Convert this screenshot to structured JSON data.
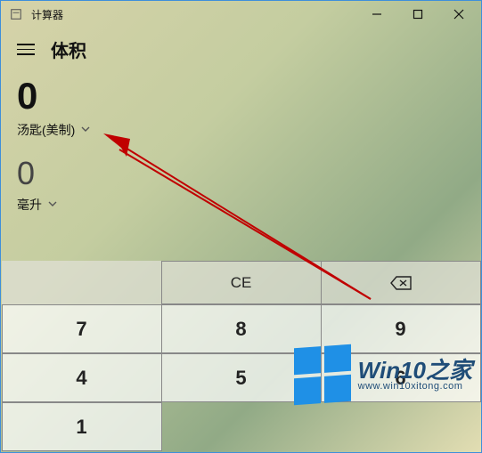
{
  "titlebar": {
    "title": "计算器"
  },
  "header": {
    "mode": "体积"
  },
  "conversion": {
    "from_value": "0",
    "from_unit": "汤匙(美制)",
    "to_value": "0",
    "to_unit": "毫升"
  },
  "keypad": {
    "ce": "CE",
    "k7": "7",
    "k8": "8",
    "k9": "9",
    "k4": "4",
    "k5": "5",
    "k6": "6",
    "k1": "1"
  },
  "watermark": {
    "text_main": "Win10之家",
    "text_sub": "www.win10xitong.com"
  }
}
